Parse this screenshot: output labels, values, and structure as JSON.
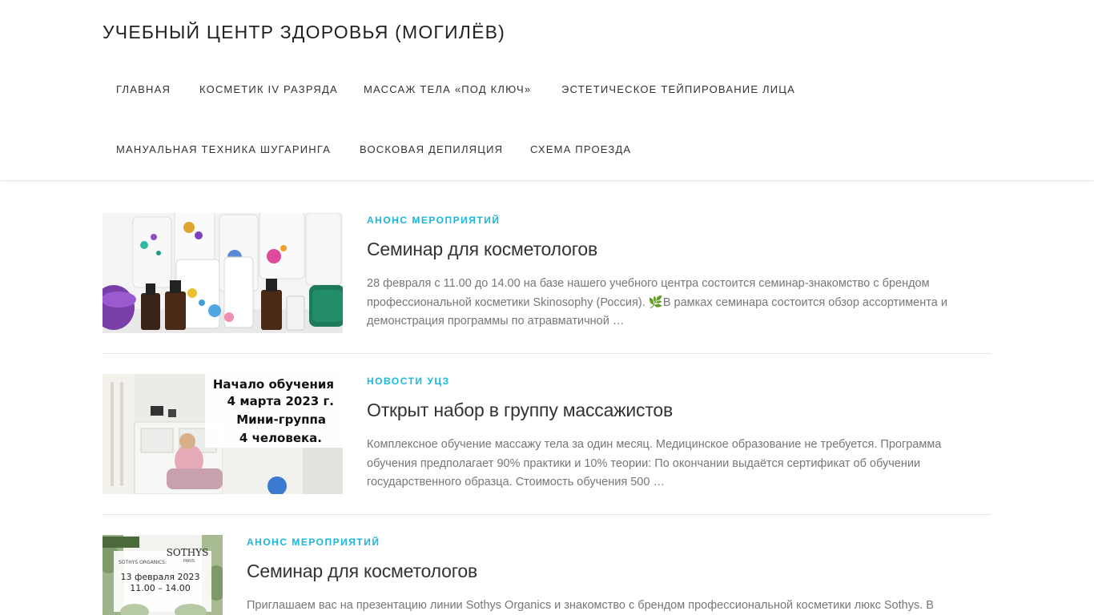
{
  "site": {
    "title": "УЧЕБНЫЙ ЦЕНТР ЗДОРОВЬЯ (МОГИЛЁВ)"
  },
  "nav": {
    "items": [
      {
        "label": "ГЛАВНАЯ"
      },
      {
        "label": "КОСМЕТИК IV РАЗРЯДА"
      },
      {
        "label": "МАССАЖ ТЕЛА «ПОД КЛЮЧ»"
      },
      {
        "label": "ЭСТЕТИЧЕСКОЕ ТЕЙПИРОВАНИЕ ЛИЦА"
      },
      {
        "label": "МАНУАЛЬНАЯ ТЕХНИКА ШУГАРИНГА"
      },
      {
        "label": "ВОСКОВАЯ ДЕПИЛЯЦИЯ"
      },
      {
        "label": "СХЕМА ПРОЕЗДА"
      }
    ]
  },
  "posts": [
    {
      "category": "АНОНС МЕРОПРИЯТИЙ",
      "title": "Семинар для косметологов",
      "excerpt_part1": "28 февраля с 11.00 до 14.00 на базе нашего учебного центра состоится семинар-знакомство с брендом профессиональной косметики Skinosophy (Россия). ",
      "emoji": "🌿",
      "excerpt_part2": "В рамках семинара состоится обзор ассортимента и демонстрация программы по атравматичной …"
    },
    {
      "category": "НОВОСТИ УЦЗ",
      "title": "Открыт набор в группу массажистов",
      "excerpt": "Комплексное обучение массажу тела за один месяц. Медицинское образование не требуется. Программа обучения предполагает 90% практики и 10% теории: По окончании выдаётся сертификат об обучении государственного образца. Стоимость обучения 500 …",
      "image_text": {
        "line1": "Начало обучения",
        "line2": "4 марта 2023 г.",
        "line3": "Мини-группа",
        "line4": "4 человека."
      }
    },
    {
      "category": "АНОНС МЕРОПРИЯТИЙ",
      "title": "Семинар для косметологов",
      "excerpt": "Приглашаем вас на презентацию линии Sothys Organics и знакомство с брендом профессиональной косметики люкс Sothys. В",
      "image_text": {
        "brand": "SOTHYS",
        "brand_sub": "PARIS",
        "sub": "SOTHYS ORGANICS:",
        "date": "13 февраля 2023",
        "time": "11.00 – 14.00"
      }
    }
  ],
  "colors": {
    "accent": "#1ab7dc",
    "text": "#333333",
    "muted": "#777777",
    "divider": "#e6e6e6"
  }
}
